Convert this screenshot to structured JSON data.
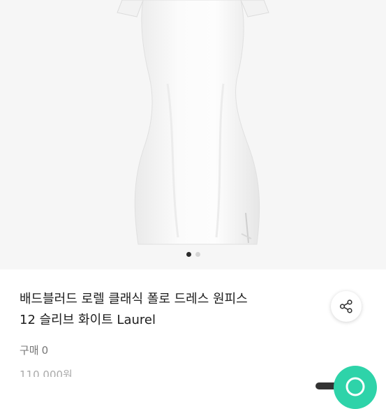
{
  "product": {
    "title_line1": "배드블러드 로렐 클래식 폴로 드레스 원피스",
    "title_line2": "12 슬리브 화이트 Laurel",
    "purchase_label": "구매",
    "purchase_count": "0",
    "price_partial": "110,000원"
  },
  "gallery": {
    "dots": [
      {
        "active": true
      },
      {
        "active": false
      }
    ]
  },
  "icons": {
    "share": "share-icon",
    "chat": "chat-icon"
  },
  "colors": {
    "accent": "#2ed3a9",
    "image_background": "#f6f6f6"
  }
}
